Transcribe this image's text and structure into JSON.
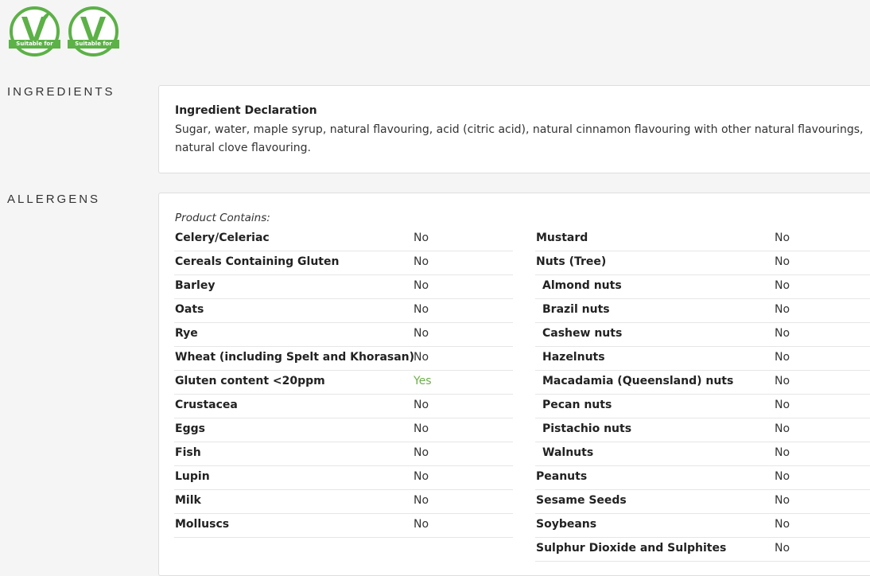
{
  "badges": [
    {
      "icon": "vegan-v-icon",
      "text": "Suitable for"
    },
    {
      "icon": "vegetarian-v-icon",
      "text": "Suitable for"
    }
  ],
  "colors": {
    "badge_green": "#5cb147",
    "yes_green": "#6cb04a"
  },
  "ingredients": {
    "section_label": "INGREDIENTS",
    "title": "Ingredient Declaration",
    "text": "Sugar, water, maple syrup, natural flavouring, acid (citric acid), natural cinnamon flavouring with other natural flavourings, natural clove flavouring."
  },
  "allergens": {
    "section_label": "ALLERGENS",
    "contains_label": "Product Contains:",
    "left": [
      {
        "name": "Celery/Celeriac",
        "value": "No"
      },
      {
        "name": "Cereals Containing Gluten",
        "value": "No"
      },
      {
        "name": "Barley",
        "value": "No"
      },
      {
        "name": "Oats",
        "value": "No"
      },
      {
        "name": "Rye",
        "value": "No"
      },
      {
        "name": "Wheat (including Spelt and Khorasan)",
        "value": "No"
      },
      {
        "name": "Gluten content <20ppm",
        "value": "Yes"
      },
      {
        "name": "Crustacea",
        "value": "No"
      },
      {
        "name": "Eggs",
        "value": "No"
      },
      {
        "name": "Fish",
        "value": "No"
      },
      {
        "name": "Lupin",
        "value": "No"
      },
      {
        "name": "Milk",
        "value": "No"
      },
      {
        "name": "Molluscs",
        "value": "No"
      }
    ],
    "right": [
      {
        "name": "Mustard",
        "value": "No"
      },
      {
        "name": "Nuts (Tree)",
        "value": "No"
      },
      {
        "name": "Almond nuts",
        "value": "No"
      },
      {
        "name": "Brazil nuts",
        "value": "No"
      },
      {
        "name": "Cashew nuts",
        "value": "No"
      },
      {
        "name": "Hazelnuts",
        "value": "No"
      },
      {
        "name": "Macadamia (Queensland) nuts",
        "value": "No"
      },
      {
        "name": "Pecan nuts",
        "value": "No"
      },
      {
        "name": "Pistachio nuts",
        "value": "No"
      },
      {
        "name": "Walnuts",
        "value": "No"
      },
      {
        "name": "Peanuts",
        "value": "No"
      },
      {
        "name": "Sesame Seeds",
        "value": "No"
      },
      {
        "name": "Soybeans",
        "value": "No"
      },
      {
        "name": "Sulphur Dioxide and Sulphites",
        "value": "No"
      }
    ]
  }
}
